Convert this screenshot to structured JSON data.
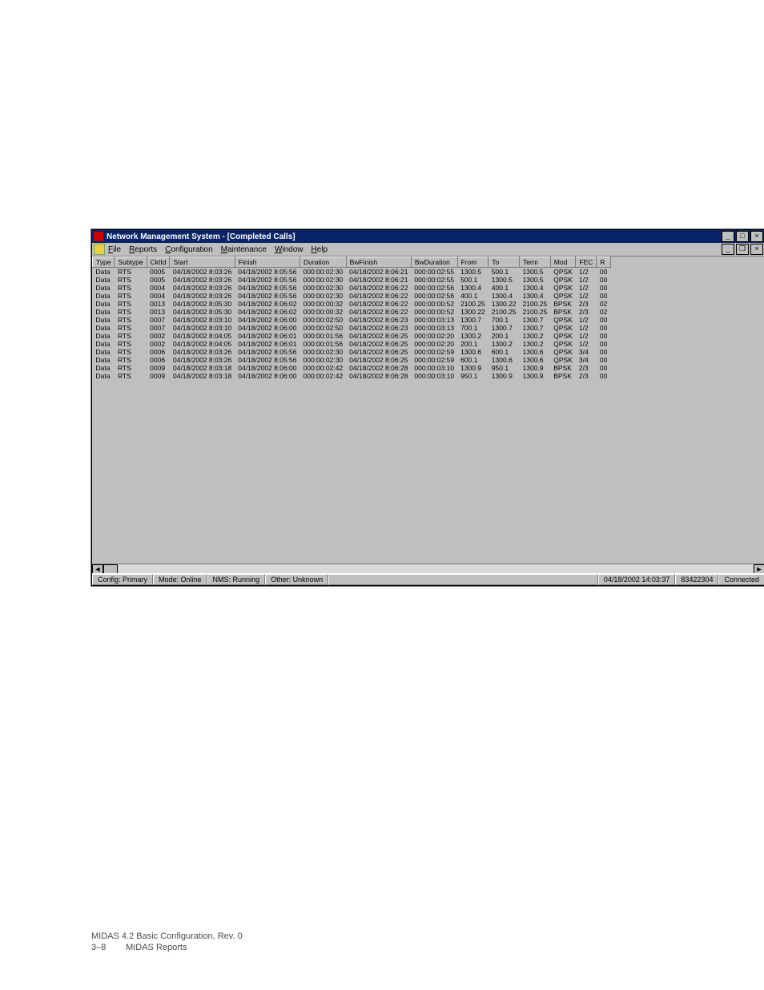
{
  "titlebar": {
    "title": "Network Management System - [Completed Calls]"
  },
  "menu": {
    "file": "File",
    "reports": "Reports",
    "configuration": "Configuration",
    "maintenance": "Maintenance",
    "window": "Window",
    "help": "Help"
  },
  "columns": [
    "Type",
    "Subtype",
    "CktId",
    "Start",
    "Finish",
    "Duration",
    "BwFinish",
    "BwDuration",
    "From",
    "To",
    "Term",
    "Mod",
    "FEC",
    "R"
  ],
  "rows": [
    {
      "Type": "Data",
      "Subtype": "RTS",
      "CktId": "0005",
      "Start": "04/18/2002 8:03:26",
      "Finish": "04/18/2002 8:05:56",
      "Duration": "000:00:02:30",
      "BwFinish": "04/18/2002 8:06:21",
      "BwDuration": "000:00:02:55",
      "From": "1300.5",
      "To": "500.1",
      "Term": "1300.5",
      "Mod": "QPSK",
      "FEC": "1/2",
      "R": "00"
    },
    {
      "Type": "Data",
      "Subtype": "RTS",
      "CktId": "0005",
      "Start": "04/18/2002 8:03:26",
      "Finish": "04/18/2002 8:05:56",
      "Duration": "000:00:02:30",
      "BwFinish": "04/18/2002 8:06:21",
      "BwDuration": "000:00:02:55",
      "From": "500.1",
      "To": "1300.5",
      "Term": "1300.5",
      "Mod": "QPSK",
      "FEC": "1/2",
      "R": "00"
    },
    {
      "Type": "Data",
      "Subtype": "RTS",
      "CktId": "0004",
      "Start": "04/18/2002 8:03:26",
      "Finish": "04/18/2002 8:05:56",
      "Duration": "000:00:02:30",
      "BwFinish": "04/18/2002 8:06:22",
      "BwDuration": "000:00:02:56",
      "From": "1300.4",
      "To": "400.1",
      "Term": "1300.4",
      "Mod": "QPSK",
      "FEC": "1/2",
      "R": "00"
    },
    {
      "Type": "Data",
      "Subtype": "RTS",
      "CktId": "0004",
      "Start": "04/18/2002 8:03:26",
      "Finish": "04/18/2002 8:05:56",
      "Duration": "000:00:02:30",
      "BwFinish": "04/18/2002 8:06:22",
      "BwDuration": "000:00:02:56",
      "From": "400.1",
      "To": "1300.4",
      "Term": "1300.4",
      "Mod": "QPSK",
      "FEC": "1/2",
      "R": "00"
    },
    {
      "Type": "Data",
      "Subtype": "RTS",
      "CktId": "0013",
      "Start": "04/18/2002 8:05:30",
      "Finish": "04/18/2002 8:06:02",
      "Duration": "000:00:00:32",
      "BwFinish": "04/18/2002 8:06:22",
      "BwDuration": "000:00:00:52",
      "From": "2100.25",
      "To": "1300.22",
      "Term": "2100.25",
      "Mod": "BPSK",
      "FEC": "2/3",
      "R": "02"
    },
    {
      "Type": "Data",
      "Subtype": "RTS",
      "CktId": "0013",
      "Start": "04/18/2002 8:05:30",
      "Finish": "04/18/2002 8:06:02",
      "Duration": "000:00:00:32",
      "BwFinish": "04/18/2002 8:06:22",
      "BwDuration": "000:00:00:52",
      "From": "1300.22",
      "To": "2100.25",
      "Term": "2100.25",
      "Mod": "BPSK",
      "FEC": "2/3",
      "R": "02"
    },
    {
      "Type": "Data",
      "Subtype": "RTS",
      "CktId": "0007",
      "Start": "04/18/2002 8:03:10",
      "Finish": "04/18/2002 8:06:00",
      "Duration": "000:00:02:50",
      "BwFinish": "04/18/2002 8:06:23",
      "BwDuration": "000:00:03:13",
      "From": "1300.7",
      "To": "700.1",
      "Term": "1300.7",
      "Mod": "QPSK",
      "FEC": "1/2",
      "R": "00"
    },
    {
      "Type": "Data",
      "Subtype": "RTS",
      "CktId": "0007",
      "Start": "04/18/2002 8:03:10",
      "Finish": "04/18/2002 8:06:00",
      "Duration": "000:00:02:50",
      "BwFinish": "04/18/2002 8:06:23",
      "BwDuration": "000:00:03:13",
      "From": "700.1",
      "To": "1300.7",
      "Term": "1300.7",
      "Mod": "QPSK",
      "FEC": "1/2",
      "R": "00"
    },
    {
      "Type": "Data",
      "Subtype": "RTS",
      "CktId": "0002",
      "Start": "04/18/2002 8:04:05",
      "Finish": "04/18/2002 8:06:01",
      "Duration": "000:00:01:56",
      "BwFinish": "04/18/2002 8:06:25",
      "BwDuration": "000:00:02:20",
      "From": "1300.2",
      "To": "200.1",
      "Term": "1300.2",
      "Mod": "QPSK",
      "FEC": "1/2",
      "R": "00"
    },
    {
      "Type": "Data",
      "Subtype": "RTS",
      "CktId": "0002",
      "Start": "04/18/2002 8:04:05",
      "Finish": "04/18/2002 8:06:01",
      "Duration": "000:00:01:56",
      "BwFinish": "04/18/2002 8:06:25",
      "BwDuration": "000:00:02:20",
      "From": "200.1",
      "To": "1300.2",
      "Term": "1300.2",
      "Mod": "QPSK",
      "FEC": "1/2",
      "R": "00"
    },
    {
      "Type": "Data",
      "Subtype": "RTS",
      "CktId": "0006",
      "Start": "04/18/2002 8:03:26",
      "Finish": "04/18/2002 8:05:56",
      "Duration": "000:00:02:30",
      "BwFinish": "04/18/2002 8:06:25",
      "BwDuration": "000:00:02:59",
      "From": "1300.6",
      "To": "600.1",
      "Term": "1300.6",
      "Mod": "QPSK",
      "FEC": "3/4",
      "R": "00"
    },
    {
      "Type": "Data",
      "Subtype": "RTS",
      "CktId": "0006",
      "Start": "04/18/2002 8:03:26",
      "Finish": "04/18/2002 8:05:56",
      "Duration": "000:00:02:30",
      "BwFinish": "04/18/2002 8:06:25",
      "BwDuration": "000:00:02:59",
      "From": "600.1",
      "To": "1300.6",
      "Term": "1300.6",
      "Mod": "QPSK",
      "FEC": "3/4",
      "R": "00"
    },
    {
      "Type": "Data",
      "Subtype": "RTS",
      "CktId": "0009",
      "Start": "04/18/2002 8:03:18",
      "Finish": "04/18/2002 8:06:00",
      "Duration": "000:00:02:42",
      "BwFinish": "04/18/2002 8:06:28",
      "BwDuration": "000:00:03:10",
      "From": "1300.9",
      "To": "950.1",
      "Term": "1300.9",
      "Mod": "BPSK",
      "FEC": "2/3",
      "R": "00"
    },
    {
      "Type": "Data",
      "Subtype": "RTS",
      "CktId": "0009",
      "Start": "04/18/2002 8:03:18",
      "Finish": "04/18/2002 8:06:00",
      "Duration": "000:00:02:42",
      "BwFinish": "04/18/2002 8:06:28",
      "BwDuration": "000:00:03:10",
      "From": "950.1",
      "To": "1300.9",
      "Term": "1300.9",
      "Mod": "BPSK",
      "FEC": "2/3",
      "R": "00"
    }
  ],
  "status": {
    "config": "Config: Primary",
    "mode": "Mode: Online",
    "nms": "NMS: Running",
    "other": "Other: Unknown",
    "datetime": "04/18/2002 14:03:37",
    "counter": "83422304",
    "conn": "Connected"
  },
  "footer": {
    "line1": "MIDAS 4.2 Basic Configuration, Rev. 0",
    "page": "3–8",
    "section": "MIDAS Reports"
  }
}
